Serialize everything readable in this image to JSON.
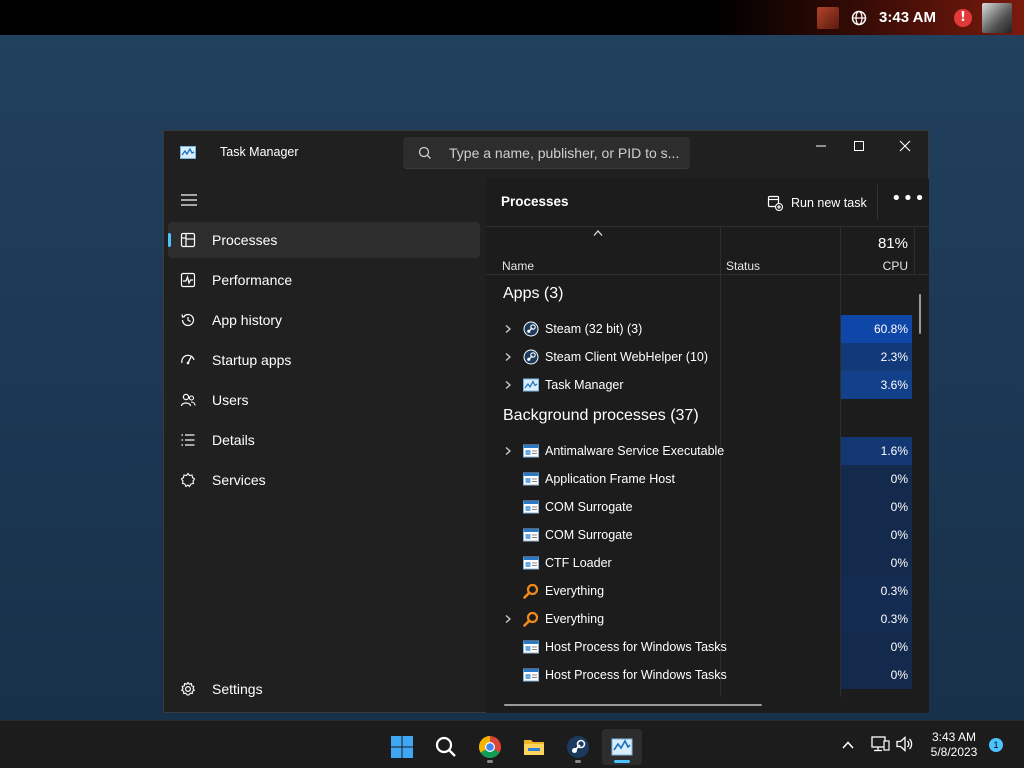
{
  "topbar": {
    "time": "3:43 AM"
  },
  "window": {
    "title": "Task Manager",
    "search_placeholder": "Type a name, publisher, or PID to s..."
  },
  "sidebar": {
    "items": [
      {
        "label": "Processes",
        "icon": "processes-icon",
        "active": true
      },
      {
        "label": "Performance",
        "icon": "performance-icon"
      },
      {
        "label": "App history",
        "icon": "app-history-icon"
      },
      {
        "label": "Startup apps",
        "icon": "startup-apps-icon"
      },
      {
        "label": "Users",
        "icon": "users-icon"
      },
      {
        "label": "Details",
        "icon": "details-icon"
      },
      {
        "label": "Services",
        "icon": "services-icon"
      }
    ],
    "settings_label": "Settings"
  },
  "content": {
    "title": "Processes",
    "run_new_task": "Run new task",
    "columns": {
      "name": "Name",
      "status": "Status",
      "cpu_total": "81%",
      "cpu": "CPU"
    },
    "groups": [
      {
        "label": "Apps (3)",
        "rows": [
          {
            "name": "Steam (32 bit) (3)",
            "cpu": "60.8%",
            "expandable": true,
            "icon": "steam-icon",
            "heat": "#0f47a8"
          },
          {
            "name": "Steam Client WebHelper (10)",
            "cpu": "2.3%",
            "expandable": true,
            "icon": "steam-icon",
            "heat": "#123a7a"
          },
          {
            "name": "Task Manager",
            "cpu": "3.6%",
            "expandable": true,
            "icon": "task-manager-icon",
            "heat": "#13408a"
          }
        ]
      },
      {
        "label": "Background processes (37)",
        "rows": [
          {
            "name": "Antimalware Service Executable",
            "cpu": "1.6%",
            "expandable": true,
            "icon": "window-app-icon",
            "heat": "#133772"
          },
          {
            "name": "Application Frame Host",
            "cpu": "0%",
            "expandable": false,
            "icon": "window-app-icon",
            "heat": "#142a4d"
          },
          {
            "name": "COM Surrogate",
            "cpu": "0%",
            "expandable": false,
            "icon": "window-app-icon",
            "heat": "#142a4d"
          },
          {
            "name": "COM Surrogate",
            "cpu": "0%",
            "expandable": false,
            "icon": "window-app-icon",
            "heat": "#142a4d"
          },
          {
            "name": "CTF Loader",
            "cpu": "0%",
            "expandable": false,
            "icon": "window-app-icon",
            "heat": "#142a4d"
          },
          {
            "name": "Everything",
            "cpu": "0.3%",
            "expandable": false,
            "icon": "everything-search-icon",
            "heat": "#142c52"
          },
          {
            "name": "Everything",
            "cpu": "0.3%",
            "expandable": true,
            "icon": "everything-search-icon",
            "heat": "#142c52"
          },
          {
            "name": "Host Process for Windows Tasks",
            "cpu": "0%",
            "expandable": false,
            "icon": "window-app-icon",
            "heat": "#142a4d"
          },
          {
            "name": "Host Process for Windows Tasks",
            "cpu": "0%",
            "expandable": false,
            "icon": "window-app-icon",
            "heat": "#142a4d"
          }
        ]
      }
    ]
  },
  "taskbar": {
    "apps": [
      "windows-start-icon",
      "search-icon",
      "chrome-icon",
      "file-explorer-icon",
      "steam-icon",
      "task-manager-icon"
    ],
    "time": "3:43 AM",
    "date": "5/8/2023",
    "notification_count": "1"
  },
  "colors": {
    "accent": "#4cc2ff",
    "background": "#202020",
    "cpu_high": "#0f47a8"
  }
}
